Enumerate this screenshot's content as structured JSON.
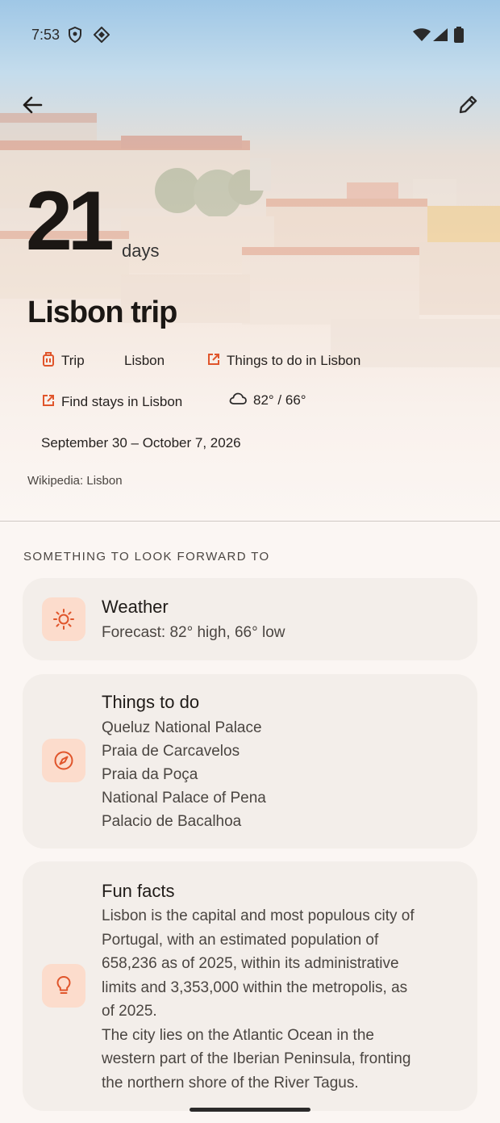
{
  "status_bar": {
    "time": "7:53"
  },
  "header": {
    "back_icon": "arrow-back-icon",
    "edit_icon": "pencil-icon"
  },
  "trip": {
    "countdown_number": "21",
    "countdown_unit": "days",
    "title": "Lisbon trip",
    "chips": [
      {
        "icon": "luggage-icon",
        "label": "Trip"
      },
      {
        "icon": "",
        "label": "Lisbon"
      },
      {
        "icon": "open-external-icon",
        "label": "Things to do in Lisbon"
      },
      {
        "icon": "open-external-icon",
        "label": "Find stays in Lisbon"
      },
      {
        "icon": "cloud-icon",
        "label": "82° / 66°"
      }
    ],
    "dates": "September 30 – October 7, 2026",
    "wiki_link": "Wikipedia: Lisbon"
  },
  "section": {
    "title": "SOMETHING TO LOOK FORWARD TO"
  },
  "cards": {
    "weather": {
      "icon": "sun-icon",
      "title": "Weather",
      "line": "Forecast: 82° high, 66° low"
    },
    "things": {
      "icon": "compass-icon",
      "title": "Things to do",
      "items": [
        "Queluz National Palace",
        "Praia de Carcavelos",
        "Praia da Poça",
        "National Palace of Pena",
        "Palacio de Bacalhoa"
      ]
    },
    "facts": {
      "icon": "lightbulb-icon",
      "title": "Fun facts",
      "lines": [
        "Lisbon is the capital and most populous city of",
        "Portugal, with an estimated population of",
        "658,236 as of 2025, within its administrative",
        "limits and 3,353,000 within the metropolis, as",
        "of 2025.",
        "The city lies on the Atlantic Ocean in the",
        "western part of the Iberian Peninsula, fronting",
        "the northern shore of the River Tagus."
      ]
    }
  },
  "colors": {
    "accent": "#e0552b",
    "icon_bg": "#fcdccc",
    "card_bg": "#f3eeea",
    "page_bg": "#fbf6f3"
  }
}
